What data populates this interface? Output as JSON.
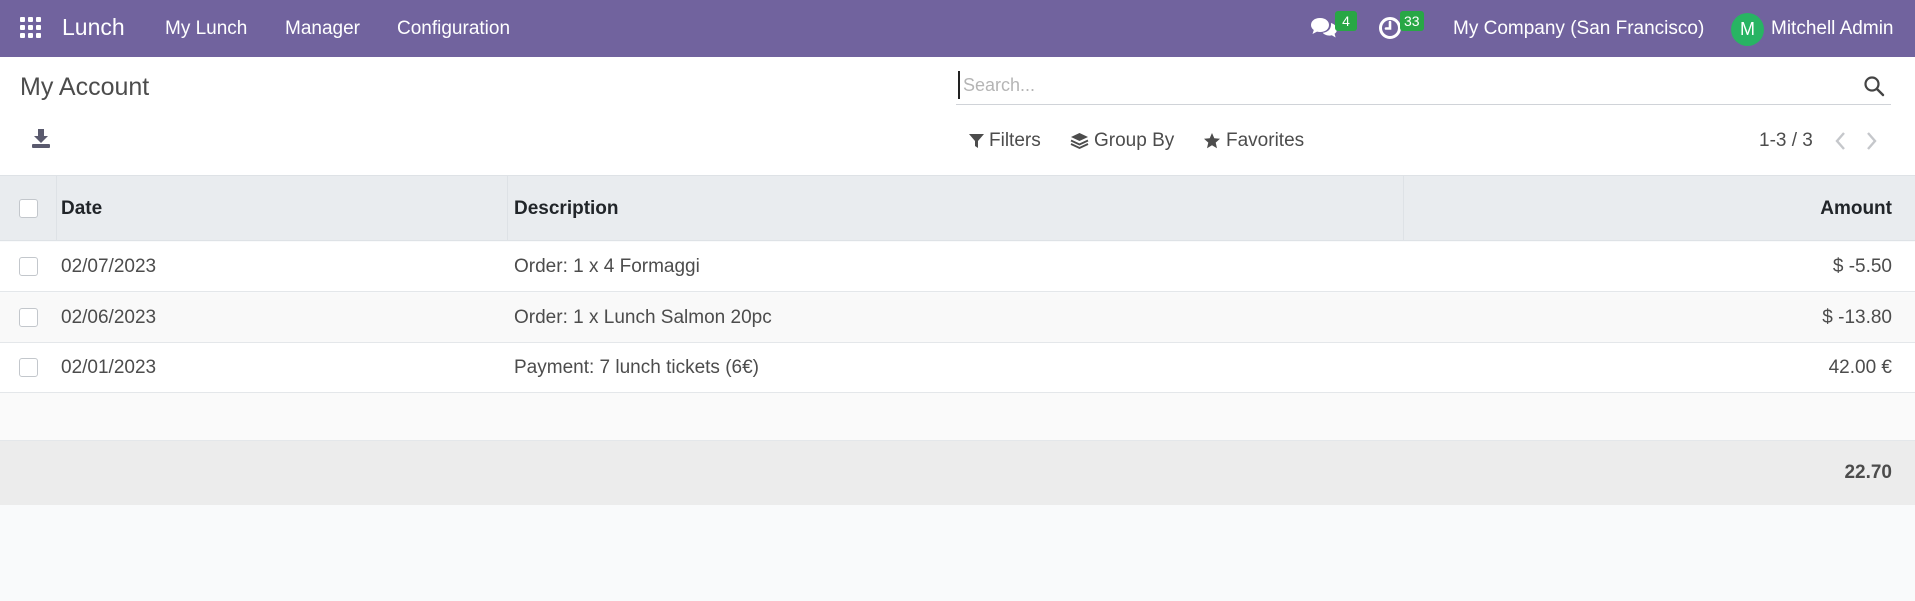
{
  "navbar": {
    "app_name": "Lunch",
    "menu": [
      "My Lunch",
      "Manager",
      "Configuration"
    ],
    "messages_count": "4",
    "activities_count": "33",
    "company": "My Company (San Francisco)",
    "avatar_initial": "M",
    "user": "Mitchell Admin",
    "colors": {
      "bar": "#71639e",
      "badge": "#28a745",
      "avatar": "#28b463"
    }
  },
  "control_panel": {
    "title": "My Account",
    "search_placeholder": "Search...",
    "filters_label": "Filters",
    "group_by_label": "Group By",
    "favorites_label": "Favorites",
    "pager": "1-3 / 3"
  },
  "table": {
    "columns": [
      "Date",
      "Description",
      "Amount"
    ],
    "rows": [
      {
        "date": "02/07/2023",
        "description": "Order: 1 x 4 Formaggi",
        "amount": "$ -5.50"
      },
      {
        "date": "02/06/2023",
        "description": "Order: 1 x Lunch Salmon 20pc",
        "amount": "$ -13.80"
      },
      {
        "date": "02/01/2023",
        "description": "Payment: 7 lunch tickets (6€)",
        "amount": "42.00 €"
      }
    ],
    "total": "22.70"
  }
}
